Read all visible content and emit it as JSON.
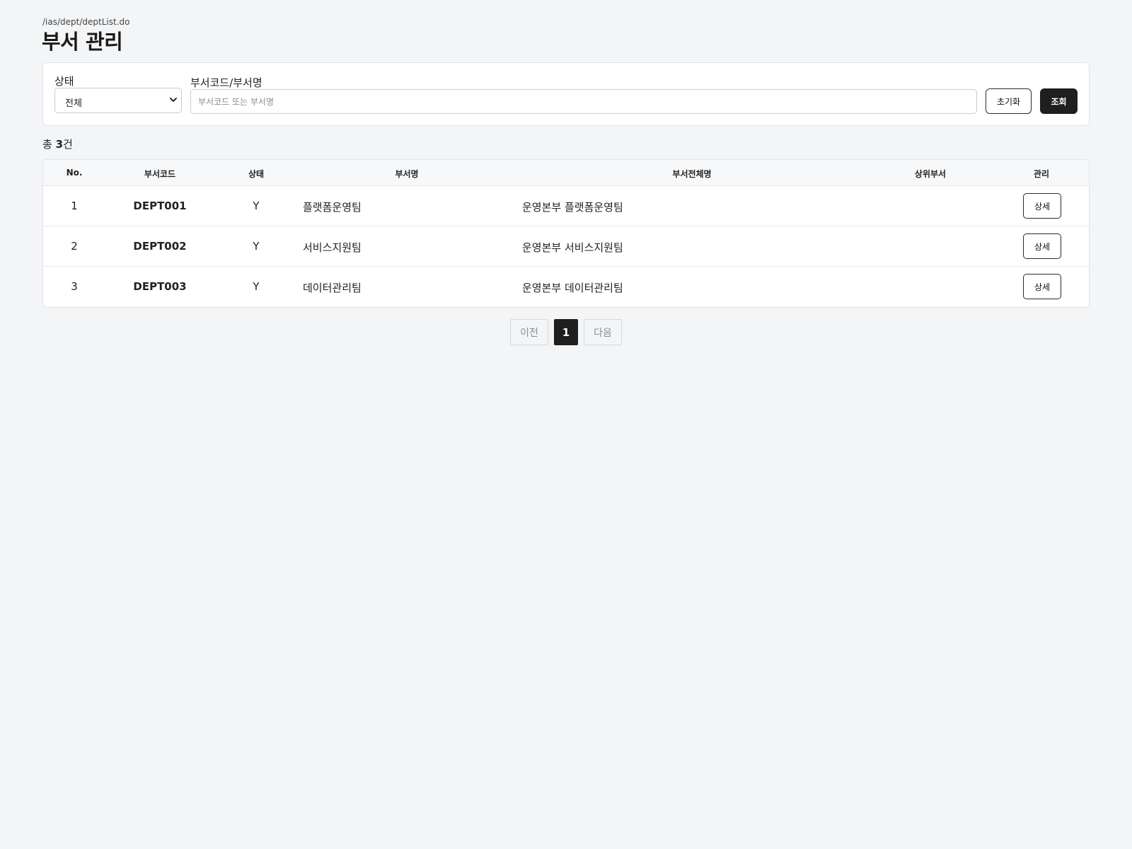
{
  "breadcrumb": "/ias/dept/deptList.do",
  "page_title": "부서 관리",
  "search": {
    "status_label": "상태",
    "status_selected": "전체",
    "keyword_label": "부서코드/부서명",
    "keyword_placeholder": "부서코드 또는 부서명",
    "keyword_value": "",
    "reset_label": "초기화",
    "search_label": "조회"
  },
  "summary": {
    "prefix": "총 ",
    "count": "3",
    "suffix": "건"
  },
  "table": {
    "headers": {
      "no": "No.",
      "code": "부서코드",
      "status": "상태",
      "name": "부서명",
      "full_name": "부서전체명",
      "parent": "상위부서",
      "manage": "관리"
    },
    "rows": [
      {
        "no": "1",
        "code": "DEPT001",
        "status": "Y",
        "name": "플랫폼운영팀",
        "full_name": "운영본부 플랫폼운영팀",
        "parent": "",
        "action": "상세"
      },
      {
        "no": "2",
        "code": "DEPT002",
        "status": "Y",
        "name": "서비스지원팀",
        "full_name": "운영본부 서비스지원팀",
        "parent": "",
        "action": "상세"
      },
      {
        "no": "3",
        "code": "DEPT003",
        "status": "Y",
        "name": "데이터관리팀",
        "full_name": "운영본부 데이터관리팀",
        "parent": "",
        "action": "상세"
      }
    ]
  },
  "pagination": {
    "prev_label": "이전",
    "current_page": "1",
    "next_label": "다음"
  },
  "colors": {
    "background": "#f4f5f7",
    "primary_button": "#1f1f1f",
    "border": "#e1e3e6"
  }
}
